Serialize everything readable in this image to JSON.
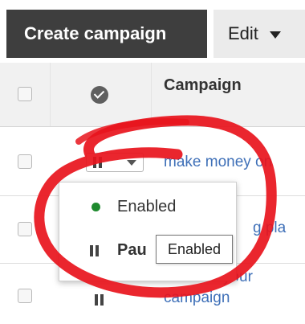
{
  "toolbar": {
    "create_label": "Create campaign",
    "edit_label": "Edit"
  },
  "table": {
    "column_campaign": "Campaign",
    "rows": [
      {
        "name": "make money on"
      },
      {
        "name": "g pla"
      },
      {
        "name": "name of your campaign"
      }
    ]
  },
  "status_menu": {
    "items": [
      {
        "label": "Enabled",
        "icon": "green-dot-icon"
      },
      {
        "label": "Pau",
        "icon": "pause-icon"
      }
    ]
  },
  "tooltip": {
    "text": "Enabled"
  },
  "colors": {
    "accent_button": "#3e3e3e",
    "link": "#3f70b8",
    "enabled_dot": "#1e8a2e",
    "annotation": "#e8141c"
  }
}
